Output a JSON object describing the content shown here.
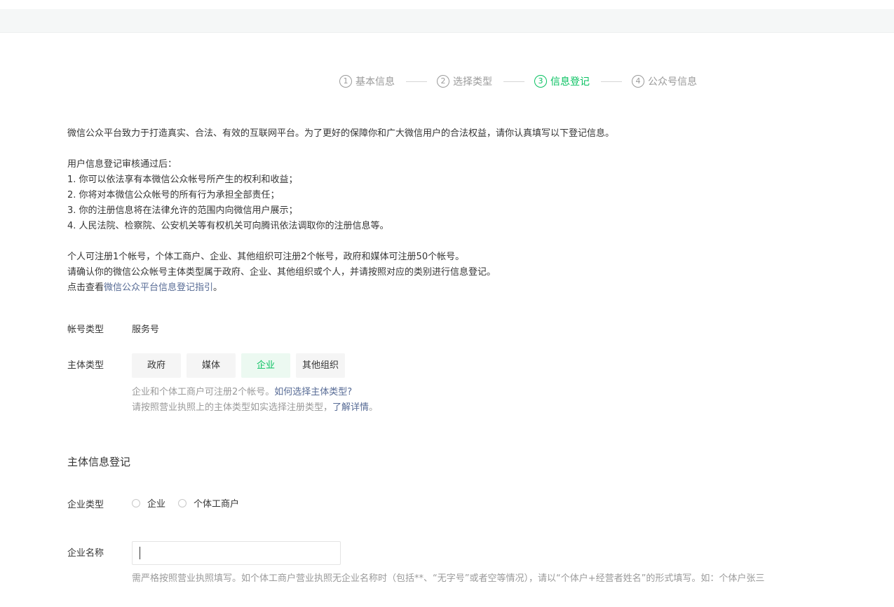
{
  "steps": [
    {
      "num": "1",
      "label": "基本信息"
    },
    {
      "num": "2",
      "label": "选择类型"
    },
    {
      "num": "3",
      "label": "信息登记"
    },
    {
      "num": "4",
      "label": "公众号信息"
    }
  ],
  "active_step": 3,
  "intro": {
    "line1": "微信公众平台致力于打造真实、合法、有效的互联网平台。为了更好的保障你和广大微信用户的合法权益，请你认真填写以下登记信息。",
    "after_title": "用户信息登记审核通过后：",
    "items": [
      "1. 你可以依法享有本微信公众帐号所产生的权利和收益；",
      "2. 你将对本微信公众帐号的所有行为承担全部责任；",
      "3. 你的注册信息将在法律允许的范围内向微信用户展示；",
      "4. 人民法院、检察院、公安机关等有权机关可向腾讯依法调取你的注册信息等。"
    ],
    "limit_text": "个人可注册1个帐号，个体工商户、企业、其他组织可注册2个帐号，政府和媒体可注册50个帐号。",
    "confirm_text": "请确认你的微信公众帐号主体类型属于政府、企业、其他组织或个人，并请按照对应的类别进行信息登记。",
    "guide_prefix": "点击查看",
    "guide_link": "微信公众平台信息登记指引",
    "guide_suffix": "。"
  },
  "account_type": {
    "label": "帐号类型",
    "value": "服务号"
  },
  "subject_type": {
    "label": "主体类型",
    "options": [
      "政府",
      "媒体",
      "企业",
      "其他组织"
    ],
    "selected": "企业",
    "hint1_text": "企业和个体工商户可注册2个帐号。",
    "hint1_link": "如何选择主体类型?",
    "hint2_text": "请按照营业执照上的主体类型如实选择注册类型，",
    "hint2_link": "了解详情",
    "hint2_suffix": "。"
  },
  "section_title": "主体信息登记",
  "company_type": {
    "label": "企业类型",
    "options": [
      "企业",
      "个体工商户"
    ]
  },
  "company_name": {
    "label": "企业名称",
    "value": "",
    "hint": "需严格按照营业执照填写。如个体工商户营业执照无企业名称时（包括**、“无字号”或者空等情况），请以“个体户+经营者姓名”的形式填写。如：个体户张三"
  },
  "colors": {
    "accent": "#07c160",
    "link": "#576b95",
    "hint": "#9a9a9a"
  }
}
